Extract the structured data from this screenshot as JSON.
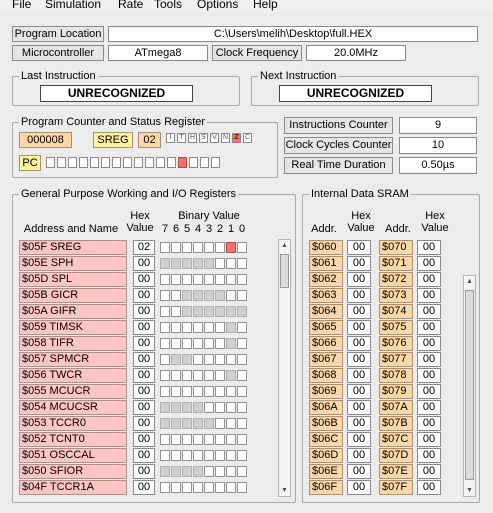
{
  "menu": [
    "File",
    "Simulation",
    "Rate",
    "Tools",
    "Options",
    "Help"
  ],
  "program_location": {
    "label": "Program Location",
    "value": "C:\\Users\\melih\\Desktop\\full.HEX"
  },
  "microcontroller": {
    "label": "Microcontroller",
    "value": "ATmega8"
  },
  "clock_frequency": {
    "label": "Clock Frequency",
    "value": "20.0MHz"
  },
  "last_instruction": {
    "title": "Last Instruction",
    "value": "UNRECOGNIZED"
  },
  "next_instruction": {
    "title": "Next Instruction",
    "value": "UNRECOGNIZED"
  },
  "pc_status": {
    "title": "Program Counter and Status Register",
    "pc_value": "000008",
    "sreg_label": "SREG",
    "sreg_value": "02",
    "sreg_flags": [
      "I",
      "T",
      "H",
      "S",
      "V",
      "N",
      "Z",
      "C"
    ],
    "sreg_flags_set": [
      false,
      false,
      false,
      false,
      false,
      false,
      true,
      false
    ],
    "pc_label": "PC",
    "pc_bits_set": [
      false,
      false,
      false,
      false,
      false,
      false,
      false,
      false,
      false,
      false,
      false,
      false,
      true,
      false,
      false,
      false
    ]
  },
  "counters": {
    "instructions_label": "Instructions Counter",
    "instructions_value": "9",
    "cycles_label": "Clock Cycles Counter",
    "cycles_value": "10",
    "realtime_label": "Real Time Duration",
    "realtime_value": "0.50µs"
  },
  "registers": {
    "title": "General Purpose Working and I/O Registers",
    "col_address": "Address and Name",
    "col_hex_1": "Hex",
    "col_hex_2": "Value",
    "col_binary": "Binary Value",
    "bit_labels": [
      "7",
      "6",
      "5",
      "4",
      "3",
      "2",
      "1",
      "0"
    ],
    "rows": [
      {
        "name": "$05F  SREG",
        "hex": "02",
        "bits": "00000010",
        "usable": "11111111"
      },
      {
        "name": "$05E  SPH",
        "hex": "00",
        "bits": "00000000",
        "usable": "00000111"
      },
      {
        "name": "$05D  SPL",
        "hex": "00",
        "bits": "00000000",
        "usable": "11111111"
      },
      {
        "name": "$05B  GICR",
        "hex": "00",
        "bits": "00000000",
        "usable": "11000011"
      },
      {
        "name": "$05A  GIFR",
        "hex": "00",
        "bits": "00000000",
        "usable": "11000000"
      },
      {
        "name": "$059  TIMSK",
        "hex": "00",
        "bits": "00000000",
        "usable": "11111101"
      },
      {
        "name": "$058  TIFR",
        "hex": "00",
        "bits": "00000000",
        "usable": "11111101"
      },
      {
        "name": "$057  SPMCR",
        "hex": "00",
        "bits": "00000000",
        "usable": "10011111"
      },
      {
        "name": "$056  TWCR",
        "hex": "00",
        "bits": "00000000",
        "usable": "11111101"
      },
      {
        "name": "$055  MCUCR",
        "hex": "00",
        "bits": "00000000",
        "usable": "11111111"
      },
      {
        "name": "$054  MCUCSR",
        "hex": "00",
        "bits": "00000000",
        "usable": "00001111"
      },
      {
        "name": "$053  TCCR0",
        "hex": "00",
        "bits": "00000000",
        "usable": "00000111"
      },
      {
        "name": "$052  TCNT0",
        "hex": "00",
        "bits": "00000000",
        "usable": "11111111"
      },
      {
        "name": "$051  OSCCAL",
        "hex": "00",
        "bits": "00000000",
        "usable": "11111111"
      },
      {
        "name": "$050  SFIOR",
        "hex": "00",
        "bits": "00000000",
        "usable": "00001111"
      },
      {
        "name": "$04F  TCCR1A",
        "hex": "00",
        "bits": "00000000",
        "usable": "11111111"
      }
    ]
  },
  "sram": {
    "title": "Internal Data SRAM",
    "col_addr": "Addr.",
    "col_hex_1": "Hex",
    "col_hex_2": "Value",
    "rows": [
      {
        "a1": "$060",
        "v1": "00",
        "a2": "$070",
        "v2": "00"
      },
      {
        "a1": "$061",
        "v1": "00",
        "a2": "$071",
        "v2": "00"
      },
      {
        "a1": "$062",
        "v1": "00",
        "a2": "$072",
        "v2": "00"
      },
      {
        "a1": "$063",
        "v1": "00",
        "a2": "$073",
        "v2": "00"
      },
      {
        "a1": "$064",
        "v1": "00",
        "a2": "$074",
        "v2": "00"
      },
      {
        "a1": "$065",
        "v1": "00",
        "a2": "$075",
        "v2": "00"
      },
      {
        "a1": "$066",
        "v1": "00",
        "a2": "$076",
        "v2": "00"
      },
      {
        "a1": "$067",
        "v1": "00",
        "a2": "$077",
        "v2": "00"
      },
      {
        "a1": "$068",
        "v1": "00",
        "a2": "$078",
        "v2": "00"
      },
      {
        "a1": "$069",
        "v1": "00",
        "a2": "$079",
        "v2": "00"
      },
      {
        "a1": "$06A",
        "v1": "00",
        "a2": "$07A",
        "v2": "00"
      },
      {
        "a1": "$06B",
        "v1": "00",
        "a2": "$07B",
        "v2": "00"
      },
      {
        "a1": "$06C",
        "v1": "00",
        "a2": "$07C",
        "v2": "00"
      },
      {
        "a1": "$06D",
        "v1": "00",
        "a2": "$07D",
        "v2": "00"
      },
      {
        "a1": "$06E",
        "v1": "00",
        "a2": "$07E",
        "v2": "00"
      },
      {
        "a1": "$06F",
        "v1": "00",
        "a2": "$07F",
        "v2": "00"
      }
    ]
  },
  "colors": {
    "register_name_bg": "#ffc4c4",
    "sram_addr_bg": "#ffd7a8",
    "bit_on": "#ff7070",
    "bit_dim": "#d0d0d0"
  }
}
